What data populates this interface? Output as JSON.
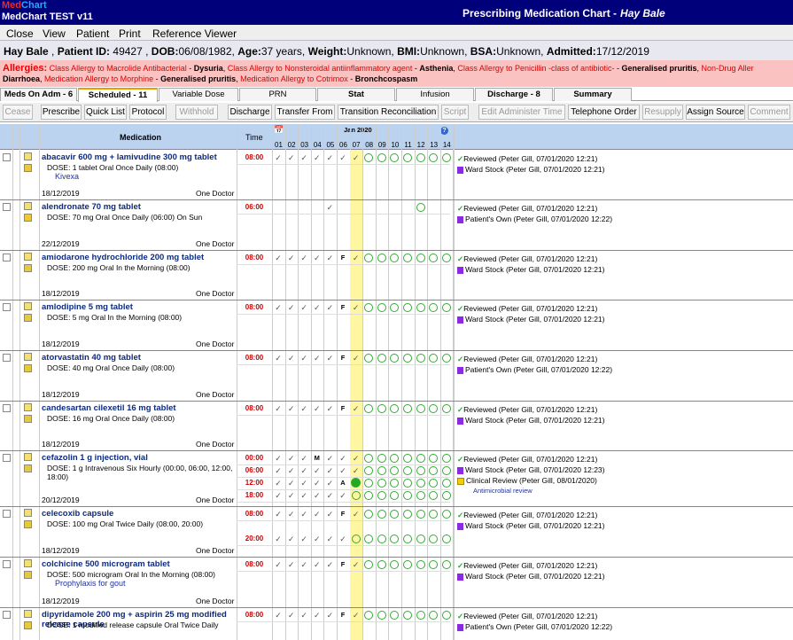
{
  "app": {
    "logo_a": "Med",
    "logo_b": "Chart",
    "title": "MedChart TEST v11",
    "chart_title": "Prescribing Medication Chart -",
    "patient_name": "Hay Bale"
  },
  "menu": [
    "Close",
    "View",
    "Patient",
    "Print",
    "Reference Viewer"
  ],
  "patient": {
    "name": "Hay Bale",
    "id_label": "Patient ID:",
    "id": "49427",
    "dob_label": "DOB:",
    "dob": "06/08/1982",
    "age_label": "Age:",
    "age": "37 years",
    "weight_label": "Weight:",
    "weight": "Unknown",
    "bmi_label": "BMI:",
    "bmi": "Unknown",
    "bsa_label": "BSA:",
    "bsa": "Unknown",
    "admitted_label": "Admitted:",
    "admitted": "17/12/2019"
  },
  "allergies": {
    "label": "Allergies:",
    "line1": [
      [
        "Class Allergy to Macrolide Antibacterial",
        "Dysuria"
      ],
      [
        "Class Allergy to Nonsteroidal antiinflammatory agent",
        "Asthenia"
      ],
      [
        "Class Allergy to Penicillin -class of antibiotic-",
        "Generalised pruritis"
      ],
      [
        "Non-Drug Aller",
        ""
      ]
    ],
    "line2": [
      [
        "",
        "Diarrhoea"
      ],
      [
        "Medication Allergy to Morphine",
        "Generalised pruritis"
      ],
      [
        "Medication Allergy to Cotrimox",
        "Bronchcospasm"
      ]
    ]
  },
  "tabs": [
    "Meds On Adm - 6",
    "Scheduled - 11",
    "Variable Dose",
    "PRN",
    "Stat",
    "Infusion",
    "Discharge - 8",
    "Summary"
  ],
  "toolbar": [
    "Cease",
    "Prescribe",
    "Quick List",
    "Protocol",
    "Withhold",
    "Discharge",
    "Transfer From",
    "Transition Reconciliation",
    "Script",
    "Edit Administer Time",
    "Telephone Order",
    "Resupply",
    "Assign Source",
    "Comment"
  ],
  "grid": {
    "medication_header": "Medication",
    "time_header": "Time",
    "month": "Jan 2020",
    "days": [
      "01",
      "02",
      "03",
      "04",
      "05",
      "06",
      "07",
      "08",
      "09",
      "10",
      "11",
      "12",
      "13",
      "14"
    ]
  },
  "meds": [
    {
      "name": "abacavir 600 mg + lamivudine 300 mg tablet",
      "dose": "DOSE: 1 tablet Oral Once Daily (08:00)",
      "note": "Kivexa",
      "date": "18/12/2019",
      "doctor": "One Doctor",
      "times": [
        "08:00"
      ],
      "marks": [
        [
          "c",
          "c",
          "c",
          "c",
          "c",
          "c",
          "c",
          "o",
          "o",
          "o",
          "o",
          "o",
          "o",
          "o"
        ]
      ],
      "status": [
        [
          "c",
          "Reviewed (Peter Gill, 07/01/2020 12:21)"
        ],
        [
          "p",
          "Ward Stock (Peter Gill, 07/01/2020 12:21)"
        ]
      ]
    },
    {
      "name": "alendronate 70 mg tablet",
      "dose": "DOSE: 70 mg Oral Once Daily (06:00) On Sun",
      "note": "",
      "date": "22/12/2019",
      "doctor": "One Doctor",
      "times": [
        "06:00"
      ],
      "marks": [
        [
          "",
          "",
          "",
          "",
          "c",
          "",
          "",
          "",
          "",
          "",
          "",
          "o",
          "",
          ""
        ]
      ],
      "status": [
        [
          "c",
          "Reviewed (Peter Gill, 07/01/2020 12:21)"
        ],
        [
          "p",
          "Patient's Own (Peter Gill, 07/01/2020 12:22)"
        ]
      ]
    },
    {
      "name": "amiodarone hydrochloride 200 mg tablet",
      "dose": "DOSE: 200 mg Oral In the Morning (08:00)",
      "note": "",
      "date": "18/12/2019",
      "doctor": "One Doctor",
      "times": [
        "08:00"
      ],
      "marks": [
        [
          "c",
          "c",
          "c",
          "c",
          "c",
          "F",
          "c",
          "o",
          "o",
          "o",
          "o",
          "o",
          "o",
          "o"
        ]
      ],
      "status": [
        [
          "c",
          "Reviewed (Peter Gill, 07/01/2020 12:21)"
        ],
        [
          "p",
          "Ward Stock (Peter Gill, 07/01/2020 12:21)"
        ]
      ]
    },
    {
      "name": "amlodipine 5 mg tablet",
      "dose": "DOSE: 5 mg Oral In the Morning (08:00)",
      "note": "",
      "date": "18/12/2019",
      "doctor": "One Doctor",
      "times": [
        "08:00"
      ],
      "marks": [
        [
          "c",
          "c",
          "c",
          "c",
          "c",
          "F",
          "c",
          "o",
          "o",
          "o",
          "o",
          "o",
          "o",
          "o"
        ]
      ],
      "status": [
        [
          "c",
          "Reviewed (Peter Gill, 07/01/2020 12:21)"
        ],
        [
          "p",
          "Ward Stock (Peter Gill, 07/01/2020 12:21)"
        ]
      ]
    },
    {
      "name": "atorvastatin 40 mg tablet",
      "dose": "DOSE: 40 mg Oral Once Daily (08:00)",
      "note": "",
      "date": "18/12/2019",
      "doctor": "One Doctor",
      "times": [
        "08:00"
      ],
      "marks": [
        [
          "c",
          "c",
          "c",
          "c",
          "c",
          "F",
          "c",
          "o",
          "o",
          "o",
          "o",
          "o",
          "o",
          "o"
        ]
      ],
      "status": [
        [
          "c",
          "Reviewed (Peter Gill, 07/01/2020 12:21)"
        ],
        [
          "p",
          "Patient's Own (Peter Gill, 07/01/2020 12:22)"
        ]
      ]
    },
    {
      "name": "candesartan cilexetil 16 mg tablet",
      "dose": "DOSE: 16 mg Oral Once Daily (08:00)",
      "note": "",
      "date": "18/12/2019",
      "doctor": "One Doctor",
      "times": [
        "08:00"
      ],
      "marks": [
        [
          "c",
          "c",
          "c",
          "c",
          "c",
          "F",
          "c",
          "o",
          "o",
          "o",
          "o",
          "o",
          "o",
          "o"
        ]
      ],
      "status": [
        [
          "c",
          "Reviewed (Peter Gill, 07/01/2020 12:21)"
        ],
        [
          "p",
          "Ward Stock (Peter Gill, 07/01/2020 12:21)"
        ]
      ]
    },
    {
      "name": "cefazolin 1 g injection, vial",
      "dose": "DOSE: 1 g Intravenous Six Hourly (00:00, 06:00, 12:00, 18:00)",
      "note": "",
      "date": "20/12/2019",
      "doctor": "One Doctor",
      "times": [
        "00:00",
        "06:00",
        "12:00",
        "18:00"
      ],
      "marks": [
        [
          "c",
          "c",
          "c",
          "M",
          "c",
          "c",
          "c",
          "o",
          "o",
          "o",
          "o",
          "o",
          "o",
          "o"
        ],
        [
          "c",
          "c",
          "c",
          "c",
          "c",
          "c",
          "c",
          "o",
          "o",
          "o",
          "o",
          "o",
          "o",
          "o"
        ],
        [
          "c",
          "c",
          "c",
          "c",
          "c",
          "A",
          "g",
          "o",
          "o",
          "o",
          "o",
          "o",
          "o",
          "o"
        ],
        [
          "c",
          "c",
          "c",
          "c",
          "c",
          "c",
          "o",
          "o",
          "o",
          "o",
          "o",
          "o",
          "o",
          "o"
        ]
      ],
      "status": [
        [
          "c",
          "Reviewed (Peter Gill, 07/01/2020 12:21)"
        ],
        [
          "p",
          "Ward Stock (Peter Gill, 07/01/2020 12:23)"
        ],
        [
          "y",
          "Clinical Review (Peter Gill, 08/01/2020)"
        ]
      ],
      "sub": "Antimicrobial review"
    },
    {
      "name": "celecoxib capsule",
      "dose": "DOSE: 100 mg Oral Twice Daily (08:00, 20:00)",
      "note": "",
      "date": "18/12/2019",
      "doctor": "One Doctor",
      "times": [
        "08:00",
        "20:00"
      ],
      "marks": [
        [
          "c",
          "c",
          "c",
          "c",
          "c",
          "F",
          "c",
          "o",
          "o",
          "o",
          "o",
          "o",
          "o",
          "o"
        ],
        [
          "c",
          "c",
          "c",
          "c",
          "c",
          "c",
          "o",
          "o",
          "o",
          "o",
          "o",
          "o",
          "o",
          "o"
        ]
      ],
      "status": [
        [
          "c",
          "Reviewed (Peter Gill, 07/01/2020 12:21)"
        ],
        [
          "p",
          "Ward Stock (Peter Gill, 07/01/2020 12:21)"
        ]
      ]
    },
    {
      "name": "colchicine 500 microgram tablet",
      "dose": "DOSE: 500 microgram Oral In the Morning (08:00)",
      "note": "Prophylaxis for gout",
      "date": "18/12/2019",
      "doctor": "One Doctor",
      "times": [
        "08:00"
      ],
      "marks": [
        [
          "c",
          "c",
          "c",
          "c",
          "c",
          "F",
          "c",
          "o",
          "o",
          "o",
          "o",
          "o",
          "o",
          "o"
        ]
      ],
      "status": [
        [
          "c",
          "Reviewed (Peter Gill, 07/01/2020 12:21)"
        ],
        [
          "p",
          "Ward Stock (Peter Gill, 07/01/2020 12:21)"
        ]
      ]
    },
    {
      "name": "dipyridamole 200 mg + aspirin 25 mg modified release capsule",
      "dose": "DOSE: 1 modified release capsule Oral Twice Daily",
      "note": "",
      "date": "",
      "doctor": "",
      "times": [
        "08:00"
      ],
      "marks": [
        [
          "c",
          "c",
          "c",
          "c",
          "c",
          "F",
          "c",
          "o",
          "o",
          "o",
          "o",
          "o",
          "o",
          "o"
        ]
      ],
      "status": [
        [
          "c",
          "Reviewed (Peter Gill, 07/01/2020 12:21)"
        ],
        [
          "p",
          "Patient's Own (Peter Gill, 07/01/2020 12:22)"
        ]
      ]
    }
  ]
}
